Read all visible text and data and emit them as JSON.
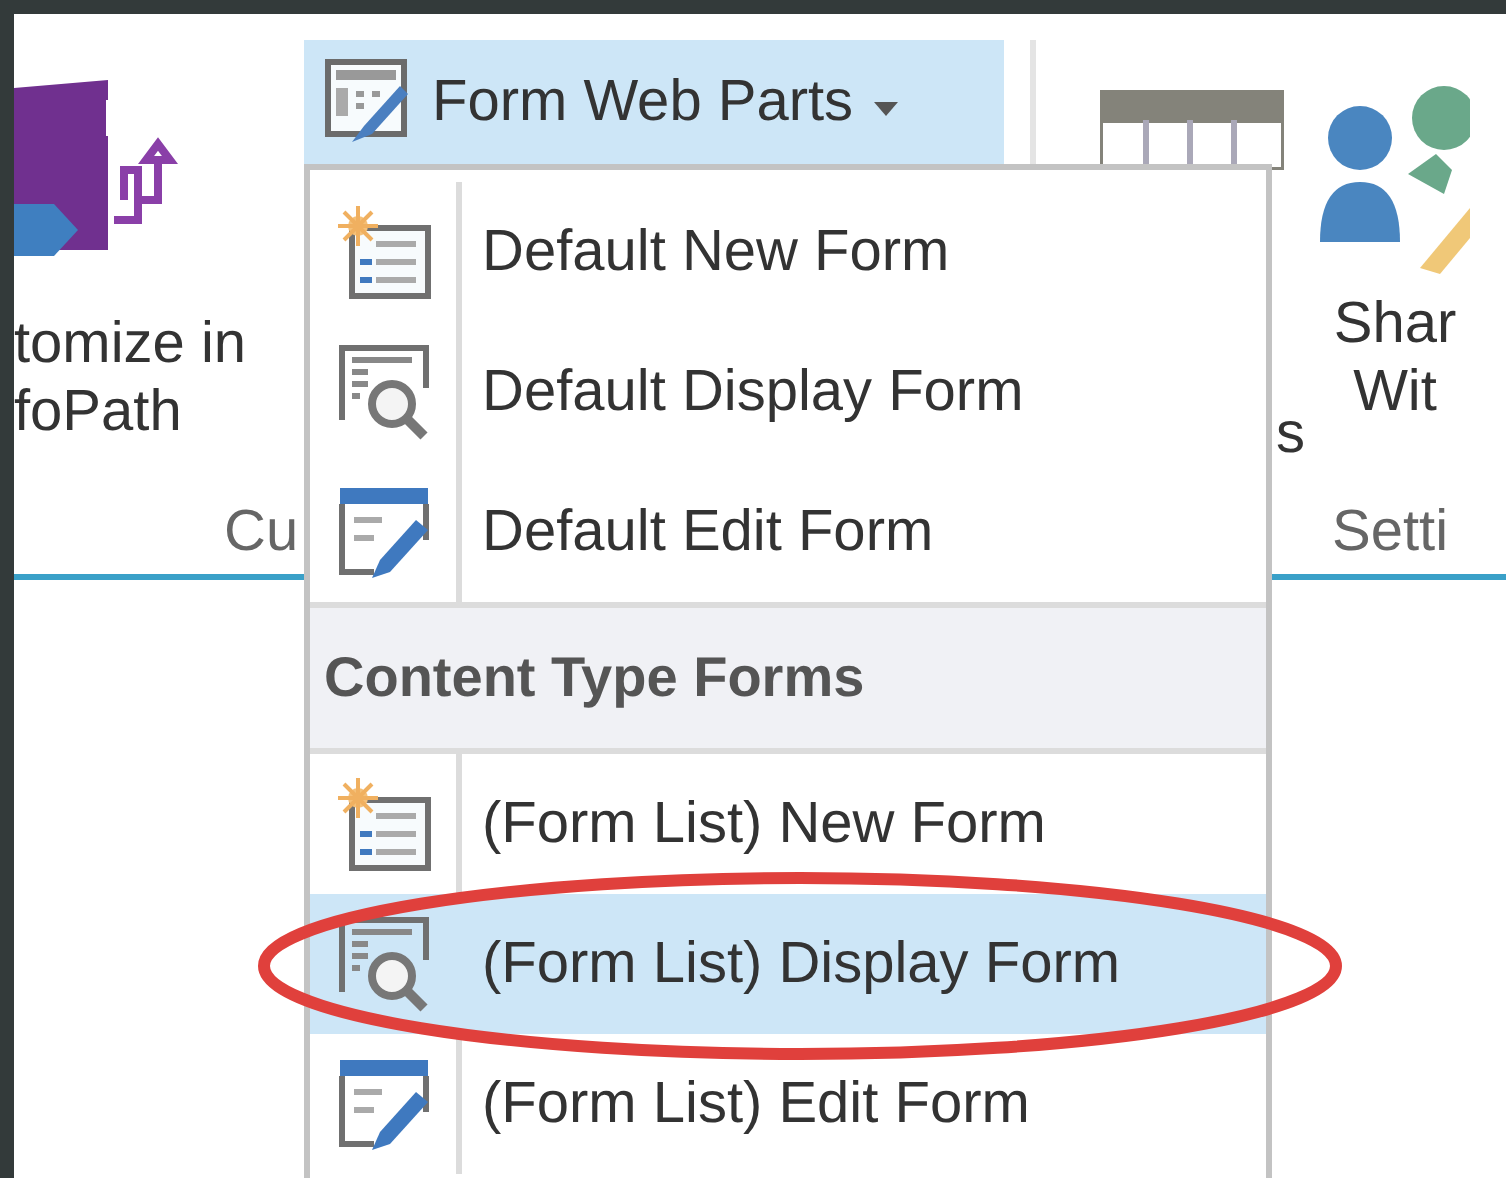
{
  "ribbon": {
    "groups": [
      {
        "kind": "infopath",
        "lines": [
          "tomize in",
          "foPath"
        ],
        "group_label": "Cu"
      },
      {
        "kind": "dropdown",
        "label": "Form Web Parts",
        "expanded": true
      },
      {
        "kind": "table",
        "lines": [
          "s"
        ]
      },
      {
        "kind": "share",
        "lines": [
          "Shar",
          "Wit"
        ],
        "group_label": "Setti"
      }
    ]
  },
  "menu": {
    "sections": [
      {
        "items": [
          {
            "label": "Default New Form",
            "kind": "new",
            "selected": false
          },
          {
            "label": "Default Display Form",
            "kind": "display",
            "selected": false
          },
          {
            "label": "Default Edit Form",
            "kind": "edit",
            "selected": false
          }
        ]
      },
      {
        "header": "Content Type Forms",
        "items": [
          {
            "label": "(Form List) New Form",
            "kind": "new",
            "selected": false
          },
          {
            "label": "(Form List) Display Form",
            "kind": "display",
            "selected": true
          },
          {
            "label": "(Form List) Edit Form",
            "kind": "edit",
            "selected": false
          }
        ]
      }
    ]
  }
}
